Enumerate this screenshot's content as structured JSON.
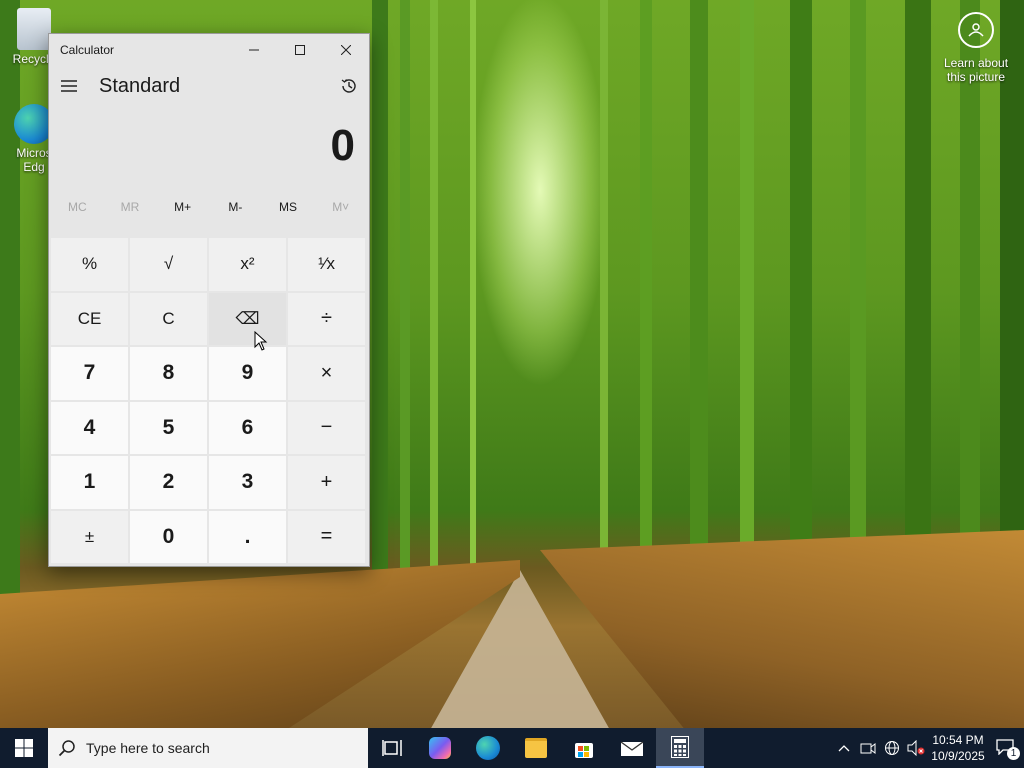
{
  "desktop": {
    "icons": [
      {
        "label": "Recycle Bin",
        "visible_label": "Recycle"
      },
      {
        "label": "Microsoft Edge",
        "visible_label_line1": "Micros",
        "visible_label_line2": "Edg"
      }
    ],
    "background_info": {
      "line1": "Learn about",
      "line2": "this picture"
    }
  },
  "calculator": {
    "window_title": "Calculator",
    "mode": "Standard",
    "display_value": "0",
    "memory_buttons": [
      {
        "label": "MC",
        "enabled": false
      },
      {
        "label": "MR",
        "enabled": false
      },
      {
        "label": "M+",
        "enabled": true
      },
      {
        "label": "M-",
        "enabled": true
      },
      {
        "label": "MS",
        "enabled": true
      },
      {
        "label": "M˅",
        "enabled": false
      }
    ],
    "keys": [
      {
        "label": "%",
        "name": "percent-button",
        "kind": "fn"
      },
      {
        "label": "√",
        "name": "square-root-button",
        "kind": "fn"
      },
      {
        "label": "x²",
        "name": "square-button",
        "kind": "fn"
      },
      {
        "label": "¹⁄x",
        "name": "reciprocal-button",
        "kind": "fn"
      },
      {
        "label": "CE",
        "name": "clear-entry-button",
        "kind": "fn"
      },
      {
        "label": "C",
        "name": "clear-button",
        "kind": "fn"
      },
      {
        "label": "⌫",
        "name": "backspace-button",
        "kind": "fn",
        "hover": true
      },
      {
        "label": "÷",
        "name": "divide-button",
        "kind": "op"
      },
      {
        "label": "7",
        "name": "digit-7-button",
        "kind": "num"
      },
      {
        "label": "8",
        "name": "digit-8-button",
        "kind": "num"
      },
      {
        "label": "9",
        "name": "digit-9-button",
        "kind": "num"
      },
      {
        "label": "×",
        "name": "multiply-button",
        "kind": "op"
      },
      {
        "label": "4",
        "name": "digit-4-button",
        "kind": "num"
      },
      {
        "label": "5",
        "name": "digit-5-button",
        "kind": "num"
      },
      {
        "label": "6",
        "name": "digit-6-button",
        "kind": "num"
      },
      {
        "label": "−",
        "name": "subtract-button",
        "kind": "op"
      },
      {
        "label": "1",
        "name": "digit-1-button",
        "kind": "num"
      },
      {
        "label": "2",
        "name": "digit-2-button",
        "kind": "num"
      },
      {
        "label": "3",
        "name": "digit-3-button",
        "kind": "num"
      },
      {
        "label": "+",
        "name": "add-button",
        "kind": "op"
      },
      {
        "label": "±",
        "name": "negate-button",
        "kind": "fn"
      },
      {
        "label": "0",
        "name": "digit-0-button",
        "kind": "num"
      },
      {
        "label": ".",
        "name": "decimal-button",
        "kind": "num"
      },
      {
        "label": "=",
        "name": "equals-button",
        "kind": "op"
      }
    ]
  },
  "taskbar": {
    "search_placeholder": "Type here to search",
    "apps": [
      "task-view-icon",
      "copilot-icon",
      "edge-icon",
      "file-explorer-icon",
      "store-icon",
      "mail-icon",
      "calculator-icon"
    ],
    "clock_time": "10:54 PM",
    "clock_date": "10/9/2025",
    "notification_count": "1"
  },
  "colors": {
    "taskbar_bg": "#101c2e",
    "calc_bg": "#e6e6e6",
    "number_key_bg": "#fafafa",
    "function_key_bg": "#f0f0f0"
  }
}
